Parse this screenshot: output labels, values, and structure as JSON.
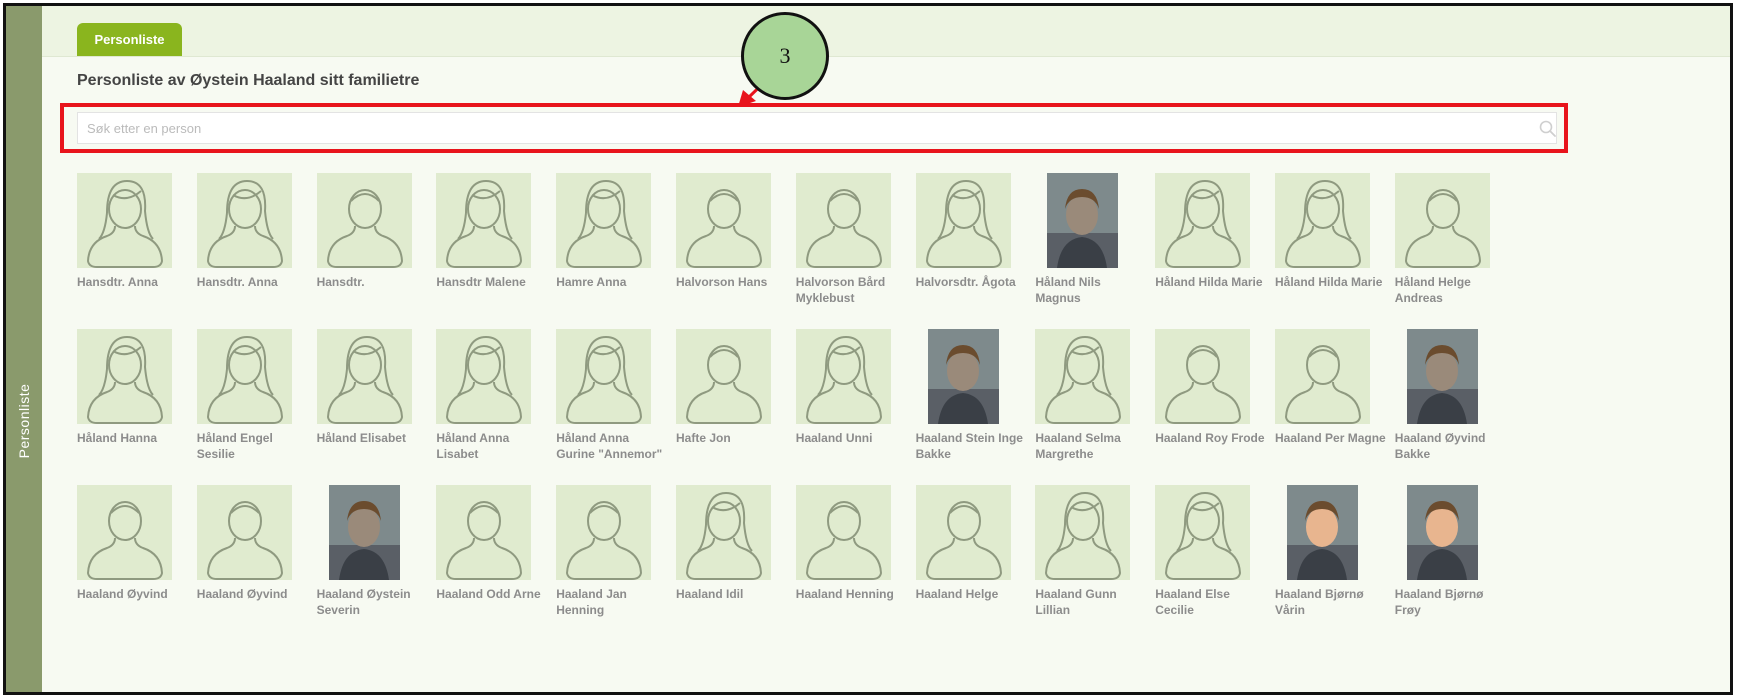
{
  "sidebar": {
    "label": "Personliste"
  },
  "tab": {
    "label": "Personliste"
  },
  "page": {
    "title": "Personliste av Øystein Haaland sitt familietre"
  },
  "search": {
    "placeholder": "Søk etter en person",
    "value": ""
  },
  "annotation": {
    "number": "3"
  },
  "colors": {
    "accent": "#8ab51e",
    "sidebar": "#8a9a6c",
    "highlight": "#e8141c",
    "callout": "#a8d597",
    "avatar_bg": "#e0ebcf",
    "avatar_line": "#8f9a80"
  },
  "people": [
    [
      {
        "name": "Hansdtr. Anna",
        "gender": "female",
        "photo": false
      },
      {
        "name": "Hansdtr. Anna",
        "gender": "female",
        "photo": false
      },
      {
        "name": "Hansdtr.",
        "gender": "male",
        "photo": false
      },
      {
        "name": "Hansdtr Malene",
        "gender": "female",
        "photo": false
      },
      {
        "name": "Hamre Anna",
        "gender": "female",
        "photo": false
      },
      {
        "name": "Halvorson Hans",
        "gender": "male",
        "photo": false
      },
      {
        "name": "Halvorson Bård Myklebust",
        "gender": "male",
        "photo": false
      },
      {
        "name": "Halvorsdtr. Ågota",
        "gender": "female",
        "photo": false
      },
      {
        "name": "Håland Nils Magnus",
        "gender": "male",
        "photo": true
      },
      {
        "name": "Håland Hilda Marie",
        "gender": "female",
        "photo": false
      },
      {
        "name": "Håland Hilda Marie",
        "gender": "female",
        "photo": false
      },
      {
        "name": "Håland Helge Andreas",
        "gender": "male",
        "photo": false
      }
    ],
    [
      {
        "name": "Håland Hanna",
        "gender": "female",
        "photo": false
      },
      {
        "name": "Håland Engel Sesilie",
        "gender": "female",
        "photo": false
      },
      {
        "name": "Håland Elisabet",
        "gender": "female",
        "photo": false
      },
      {
        "name": "Håland Anna Lisabet",
        "gender": "female",
        "photo": false
      },
      {
        "name": "Håland Anna Gurine \"Annemor\"",
        "gender": "female",
        "photo": false
      },
      {
        "name": "Hafte Jon",
        "gender": "male",
        "photo": false
      },
      {
        "name": "Haaland Unni",
        "gender": "female",
        "photo": false
      },
      {
        "name": "Haaland Stein Inge Bakke",
        "gender": "male",
        "photo": true
      },
      {
        "name": "Haaland Selma Margrethe",
        "gender": "female",
        "photo": false
      },
      {
        "name": "Haaland Roy Frode",
        "gender": "male",
        "photo": false
      },
      {
        "name": "Haaland Per Magne",
        "gender": "male",
        "photo": false
      },
      {
        "name": "Haaland Øyvind Bakke",
        "gender": "male",
        "photo": true
      }
    ],
    [
      {
        "name": "Haaland Øyvind",
        "gender": "male",
        "photo": false
      },
      {
        "name": "Haaland Øyvind",
        "gender": "male",
        "photo": false
      },
      {
        "name": "Haaland Øystein Severin",
        "gender": "male",
        "photo": true
      },
      {
        "name": "Haaland Odd Arne",
        "gender": "male",
        "photo": false
      },
      {
        "name": "Haaland Jan Henning",
        "gender": "male",
        "photo": false
      },
      {
        "name": "Haaland Idil",
        "gender": "female",
        "photo": false
      },
      {
        "name": "Haaland Henning",
        "gender": "male",
        "photo": false
      },
      {
        "name": "Haaland Helge",
        "gender": "male",
        "photo": false
      },
      {
        "name": "Haaland Gunn Lillian",
        "gender": "female",
        "photo": false
      },
      {
        "name": "Haaland Else Cecilie",
        "gender": "female",
        "photo": false
      },
      {
        "name": "Haaland Bjørnø Vårin",
        "gender": "female",
        "photo": true
      },
      {
        "name": "Haaland Bjørnø Frøy",
        "gender": "female",
        "photo": true
      }
    ]
  ]
}
